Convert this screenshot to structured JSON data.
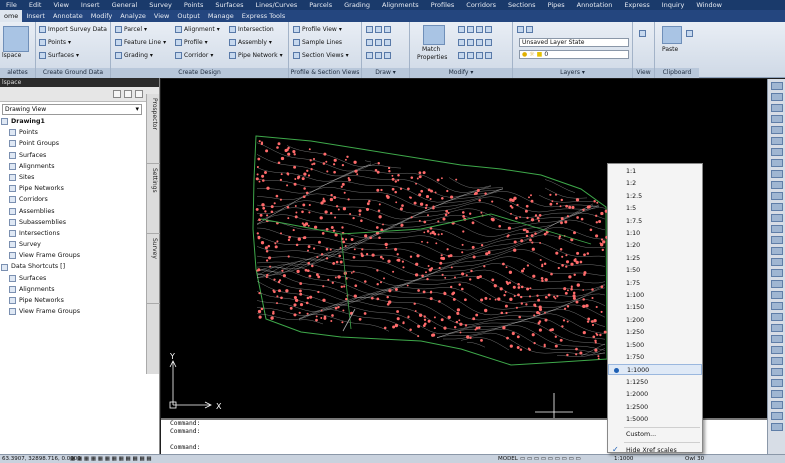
{
  "menubar": [
    "File",
    "Edit",
    "View",
    "Insert",
    "General",
    "Survey",
    "Points",
    "Surfaces",
    "Lines/Curves",
    "Parcels",
    "Grading",
    "Alignments",
    "Profiles",
    "Corridors",
    "Sections",
    "Pipes",
    "Annotation",
    "Express",
    "Inquiry",
    "Window"
  ],
  "tabs": [
    "ome",
    "Insert",
    "Annotate",
    "Modify",
    "Analyze",
    "View",
    "Output",
    "Manage",
    "Express Tools"
  ],
  "ribbon": {
    "palettes_title": "alettes",
    "toolspace_label": "lspace",
    "import_survey": "Import Survey Data",
    "points": "Points",
    "surfaces": "Surfaces",
    "create_ground_title": "Create Ground Data",
    "parcel": "Parcel",
    "feature_line": "Feature Line",
    "grading": "Grading",
    "alignment": "Alignment",
    "profile": "Profile",
    "corridor": "Corridor",
    "intersection": "Intersection",
    "assembly": "Assembly",
    "pipe_network": "Pipe Network",
    "create_design_title": "Create Design",
    "profile_view": "Profile View",
    "sample_lines": "Sample Lines",
    "section_views": "Section Views",
    "profile_section_title": "Profile & Section Views",
    "draw_title": "Draw",
    "match_properties": "Match Properties",
    "modify_title": "Modify",
    "layer_state": "Unsaved Layer State",
    "layer_name": "0",
    "layers_title": "Layers",
    "view_title": "View",
    "paste": "Paste",
    "clipboard_title": "Clipboard"
  },
  "toolspace": {
    "title": "lspace",
    "view_select": "Drawing View",
    "tree": [
      {
        "label": "Drawing1",
        "bold": true,
        "indent": 0
      },
      {
        "label": "Points",
        "indent": 1
      },
      {
        "label": "Point Groups",
        "indent": 1
      },
      {
        "label": "Surfaces",
        "indent": 1
      },
      {
        "label": "Alignments",
        "indent": 1
      },
      {
        "label": "Sites",
        "indent": 1
      },
      {
        "label": "Pipe Networks",
        "indent": 1
      },
      {
        "label": "Corridors",
        "indent": 1
      },
      {
        "label": "Assemblies",
        "indent": 1
      },
      {
        "label": "Subassemblies",
        "indent": 1
      },
      {
        "label": "Intersections",
        "indent": 1
      },
      {
        "label": "Survey",
        "indent": 1
      },
      {
        "label": "View Frame Groups",
        "indent": 1
      },
      {
        "label": "Data Shortcuts []",
        "indent": 0
      },
      {
        "label": "Surfaces",
        "indent": 1
      },
      {
        "label": "Alignments",
        "indent": 1
      },
      {
        "label": "Pipe Networks",
        "indent": 1
      },
      {
        "label": "View Frame Groups",
        "indent": 1
      }
    ],
    "vtabs": [
      "Prospector",
      "Settings",
      "Survey"
    ]
  },
  "ucs": {
    "x_label": "X",
    "y_label": "Y"
  },
  "command_lines": [
    "Command:",
    "Command:",
    "",
    "Command:"
  ],
  "status": {
    "coords": "63.3907, 32898.716, 0.0000",
    "model": "MODEL",
    "scale": "1:1000",
    "units": "Owl 30"
  },
  "scale_menu": {
    "items": [
      "1:1",
      "1:2",
      "1:2.5",
      "1:5",
      "1:7.5",
      "1:10",
      "1:20",
      "1:25",
      "1:50",
      "1:75",
      "1:100",
      "1:150",
      "1:200",
      "1:250",
      "1:500",
      "1:750",
      "1:1000",
      "1:1250",
      "1:2000",
      "1:2500",
      "1:5000"
    ],
    "selected": "1:1000",
    "custom": "Custom...",
    "hide_xref": "Hide Xref scales"
  },
  "colors": {
    "canvas": "#000000",
    "contours": "#d9d9d9",
    "points": "#ff6b6b",
    "boundary": "#4caf50",
    "menubar": "#1a3a6b"
  }
}
